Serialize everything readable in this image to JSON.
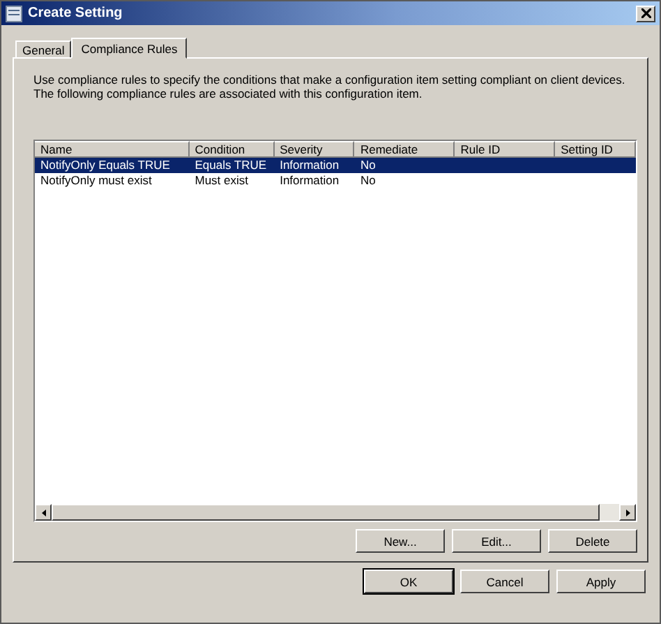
{
  "window": {
    "title": "Create Setting"
  },
  "tabs": [
    {
      "label": "General",
      "selected": false
    },
    {
      "label": "Compliance Rules",
      "selected": true
    }
  ],
  "description": "Use compliance rules to specify the conditions that make a configuration item setting compliant on client devices. The following compliance rules are associated with this configuration item.",
  "table": {
    "columns": [
      "Name",
      "Condition",
      "Severity",
      "Remediate",
      "Rule ID",
      "Setting ID"
    ],
    "rows": [
      {
        "cells": [
          "NotifyOnly Equals TRUE",
          "Equals TRUE",
          "Information",
          "No",
          "",
          ""
        ],
        "selected": true
      },
      {
        "cells": [
          "NotifyOnly must exist",
          "Must exist",
          "Information",
          "No",
          "",
          ""
        ],
        "selected": false
      }
    ]
  },
  "list_buttons": [
    "New...",
    "Edit...",
    "Delete"
  ],
  "dialog_buttons": [
    {
      "label": "OK",
      "default": true
    },
    {
      "label": "Cancel",
      "default": false
    },
    {
      "label": "Apply",
      "default": false
    }
  ]
}
